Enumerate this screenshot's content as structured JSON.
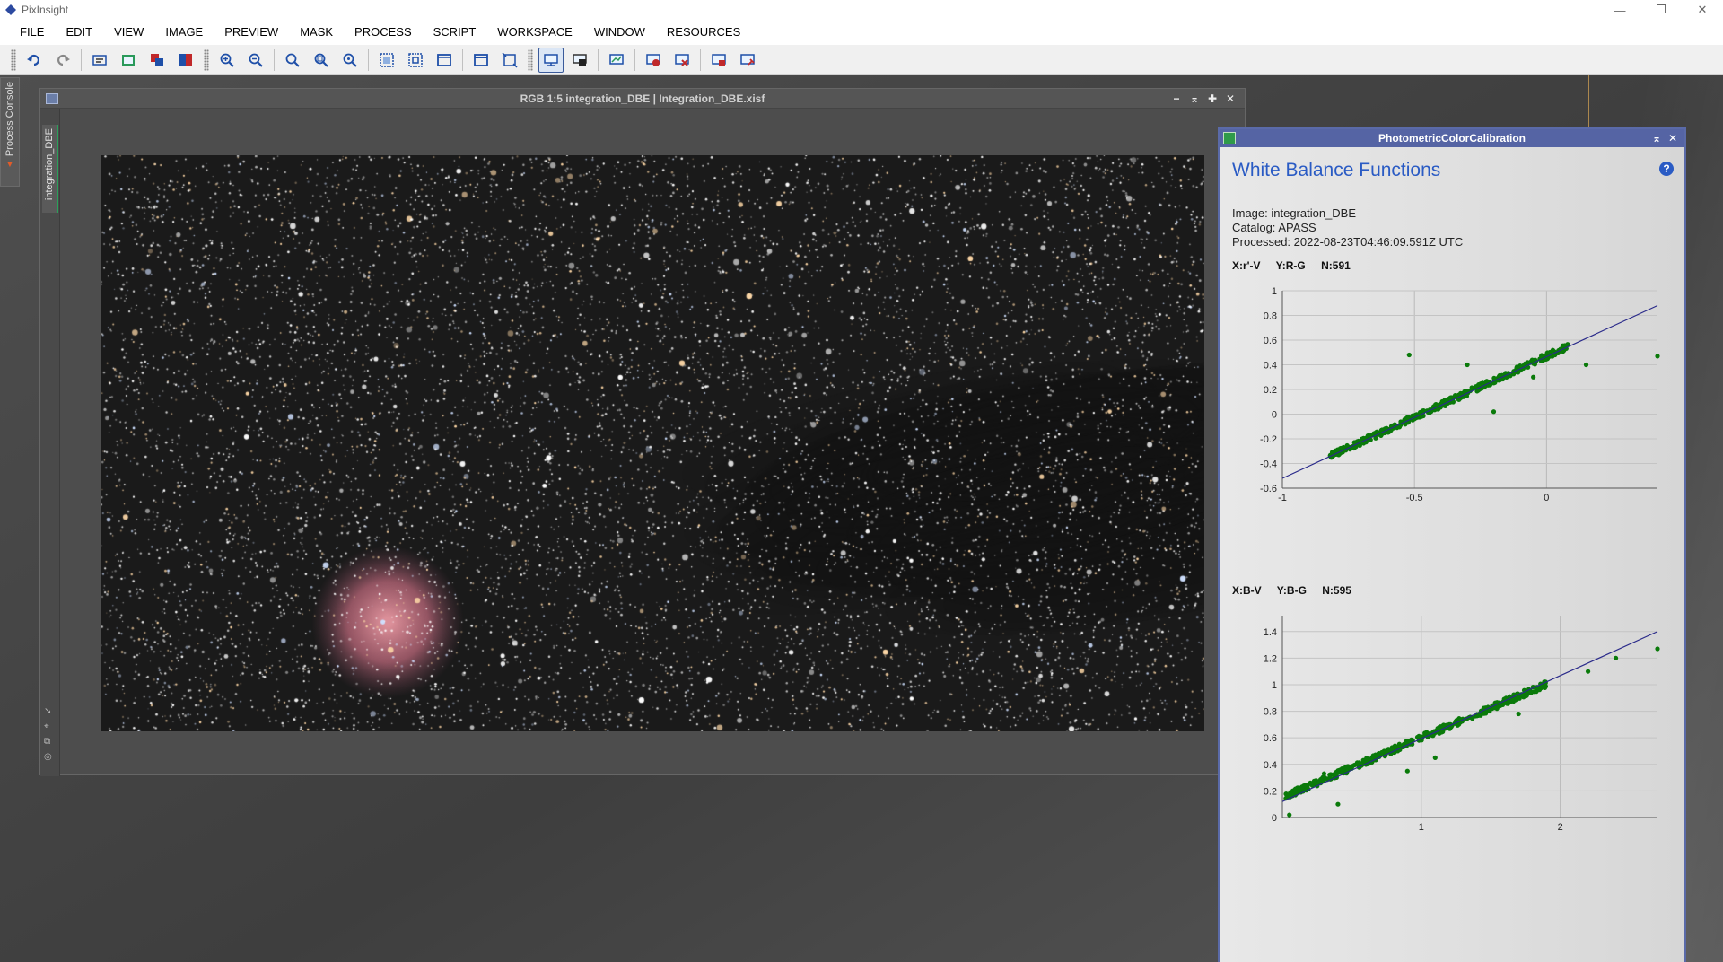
{
  "app": {
    "title": "PixInsight",
    "window_controls": [
      "—",
      "❐",
      "✕"
    ]
  },
  "menu": [
    "FILE",
    "EDIT",
    "VIEW",
    "IMAGE",
    "PREVIEW",
    "MASK",
    "PROCESS",
    "SCRIPT",
    "WORKSPACE",
    "WINDOW",
    "RESOURCES"
  ],
  "dock": {
    "process_console_label": "Process Console"
  },
  "image_window": {
    "title": "RGB 1:5 integration_DBE | Integration_DBE.xisf",
    "view_tab_label": "integration_DBE",
    "controls": [
      "−",
      "⌅",
      "✚",
      "✕"
    ]
  },
  "pcc": {
    "title": "PhotometricColorCalibration",
    "heading": "White Balance Functions",
    "help_label": "?",
    "meta": {
      "image": "Image: integration_DBE",
      "catalog": "Catalog: APASS",
      "processed": "Processed: 2022-08-23T04:46:09.591Z UTC"
    },
    "plot1": {
      "caption_x": "X:r'-V",
      "caption_y": "Y:R-G",
      "caption_n": "N:591"
    },
    "plot2": {
      "caption_x": "X:B-V",
      "caption_y": "Y:B-G",
      "caption_n": "N:595"
    }
  },
  "chart_data": [
    {
      "type": "scatter",
      "title": "",
      "xlabel": "X:r'-V",
      "ylabel": "Y:R-G",
      "count": 591,
      "xlim": [
        -1,
        0.42
      ],
      "ylim": [
        -0.6,
        1
      ],
      "x_ticks": [
        -1,
        -0.5,
        0
      ],
      "y_ticks": [
        -0.6,
        -0.4,
        -0.2,
        0,
        0.2,
        0.4,
        0.6,
        0.8,
        1
      ],
      "grid": true,
      "fit_line": {
        "x": [
          -1,
          0.42
        ],
        "y": [
          -0.52,
          0.88
        ]
      },
      "series": [
        {
          "name": "",
          "color": "#0a7a0a",
          "trend": {
            "slope": 0.99,
            "intercept": 0.47,
            "x_range": [
              -0.82,
              0.08
            ],
            "outliers": [
              [
                -0.52,
                0.48
              ],
              [
                -0.3,
                0.4
              ],
              [
                -0.2,
                0.02
              ],
              [
                0.15,
                0.4
              ],
              [
                0.42,
                0.47
              ],
              [
                -0.05,
                0.3
              ]
            ]
          }
        }
      ],
      "fit_color": "#2a2a8a"
    },
    {
      "type": "scatter",
      "title": "",
      "xlabel": "X:B-V",
      "ylabel": "Y:B-G",
      "count": 595,
      "xlim": [
        0,
        2.7
      ],
      "ylim": [
        0,
        1.52
      ],
      "x_ticks": [
        1,
        2
      ],
      "y_ticks": [
        0,
        0.2,
        0.4,
        0.6,
        0.8,
        1,
        1.2,
        1.4
      ],
      "grid": true,
      "fit_line": {
        "x": [
          0,
          2.7
        ],
        "y": [
          0.12,
          1.4
        ]
      },
      "series": [
        {
          "name": "",
          "color": "#0a7a0a",
          "trend": {
            "slope": 0.45,
            "intercept": 0.15,
            "x_range": [
              0.02,
              1.9
            ],
            "outliers": [
              [
                0.05,
                0.02
              ],
              [
                0.3,
                0.33
              ],
              [
                0.4,
                0.1
              ],
              [
                0.9,
                0.35
              ],
              [
                1.1,
                0.45
              ],
              [
                2.2,
                1.1
              ],
              [
                2.4,
                1.2
              ],
              [
                2.7,
                1.27
              ],
              [
                1.7,
                0.78
              ]
            ]
          }
        }
      ],
      "fit_color": "#2a2a8a"
    }
  ]
}
